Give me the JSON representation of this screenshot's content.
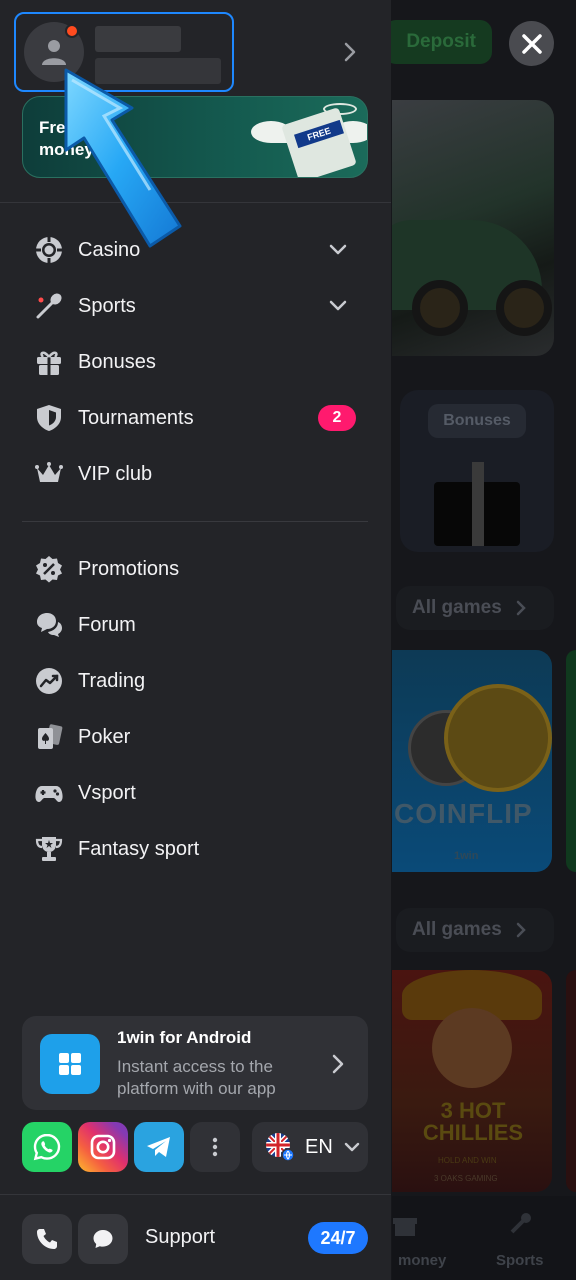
{
  "background": {
    "deposit_label": "Deposit",
    "bonuses_tag": "Bonuses",
    "all_games_1": "All games",
    "all_games_2": "All games",
    "coinflip_title": "COINFLIP",
    "coinflip_brand": "1win",
    "hot_title": "3 HOT CHILLIES",
    "hot_sub": "HOLD AND WIN",
    "hot_vendor": "3 OAKS GAMING",
    "bottom_nav": {
      "money_label": "money",
      "sports_label": "Sports"
    }
  },
  "drawer": {
    "promo": {
      "line1": "Free",
      "line2": "money",
      "stamp": "FREE"
    },
    "menu_primary": [
      {
        "label": "Casino",
        "icon": "casino-chip-icon",
        "has_chevron": true
      },
      {
        "label": "Sports",
        "icon": "sports-racket-icon",
        "has_chevron": true
      },
      {
        "label": "Bonuses",
        "icon": "gift-icon"
      },
      {
        "label": "Tournaments",
        "icon": "shield-icon",
        "badge": "2"
      },
      {
        "label": "VIP club",
        "icon": "crown-icon"
      }
    ],
    "menu_secondary": [
      {
        "label": "Promotions",
        "icon": "percent-badge-icon"
      },
      {
        "label": "Forum",
        "icon": "chat-bubbles-icon"
      },
      {
        "label": "Trading",
        "icon": "trend-chart-icon"
      },
      {
        "label": "Poker",
        "icon": "playing-cards-icon"
      },
      {
        "label": "Vsport",
        "icon": "gamepad-icon"
      },
      {
        "label": "Fantasy sport",
        "icon": "trophy-icon"
      }
    ],
    "android": {
      "title": "1win for Android",
      "subtitle": "Instant access to the platform with our app"
    },
    "language": "EN",
    "support": {
      "label": "Support",
      "badge": "24/7"
    }
  },
  "colors": {
    "drawer_bg": "#232428",
    "accent_blue": "#1e78ff",
    "badge_pink": "#ff1a6e",
    "whatsapp": "#25d366",
    "telegram": "#2aa3e0"
  }
}
